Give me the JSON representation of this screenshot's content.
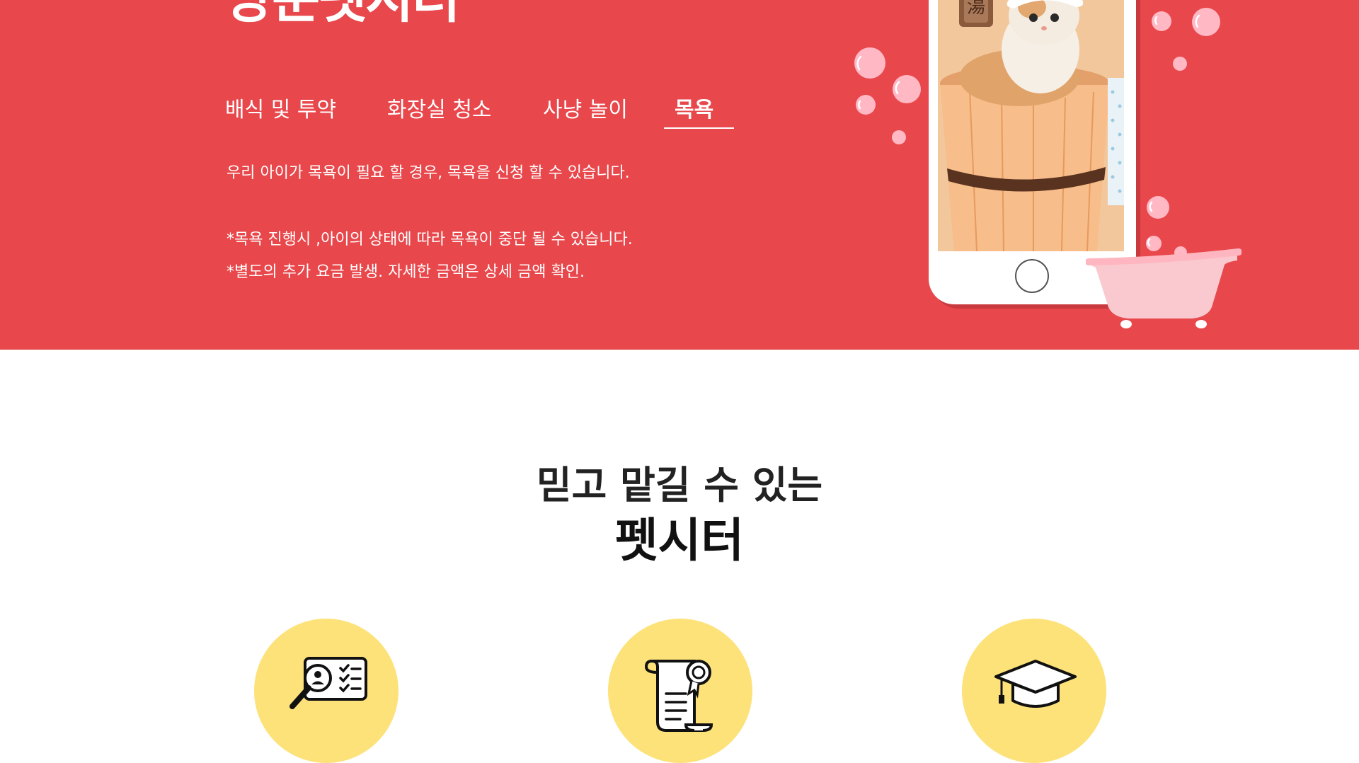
{
  "hero": {
    "title": "방문펫시터",
    "tabs": [
      {
        "label": "배식 및 투약",
        "active": false
      },
      {
        "label": "화장실 청소",
        "active": false
      },
      {
        "label": "사냥 놀이",
        "active": false
      },
      {
        "label": "목욕",
        "active": true
      }
    ],
    "description": "우리 아이가 목욕이 필요 할 경우, 목욕을 신청 할 수 있습니다.",
    "notes": [
      "*목욕 진행시 ,아이의 상태에 따라 목욕이 중단 될 수 있습니다.",
      "*별도의 추가 요금 발생. 자세한 금액은 상세 금액 확인."
    ],
    "sign_text": "湯"
  },
  "section": {
    "subtitle": "믿고 맡길 수 있는",
    "title": "펫시터"
  },
  "features": [
    {
      "icon": "profile-check-icon"
    },
    {
      "icon": "certificate-scroll-icon"
    },
    {
      "icon": "graduation-cap-icon"
    }
  ],
  "colors": {
    "hero_bg": "#e8474b",
    "feature_circle": "#fde27a",
    "bubble": "#ffb8c4",
    "tub": "#f9c9cf"
  }
}
